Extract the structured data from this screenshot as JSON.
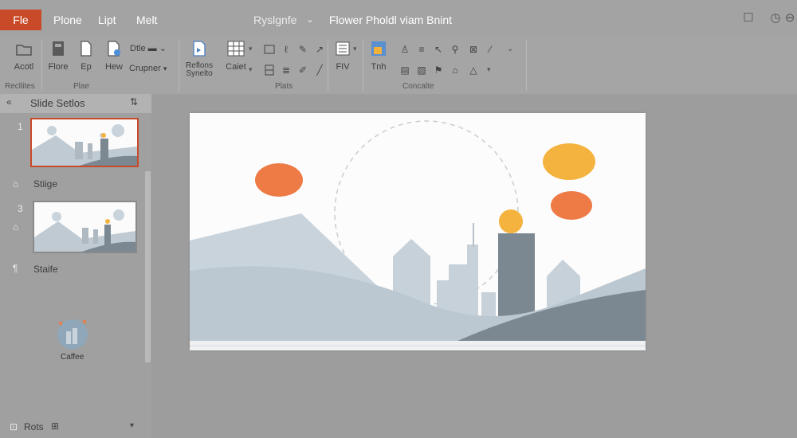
{
  "menu": {
    "file": "Fle",
    "items": [
      "Plone",
      "Lipt",
      "Melt"
    ],
    "doc_title": "Ryslgnfe",
    "app_title": "Flower Pholdl viam Bnint"
  },
  "ribbon": {
    "buttons": {
      "acont": "Acotl",
      "flore": "Flore",
      "ep": "Ep",
      "hew": "Hew",
      "cruprner": "Crupner",
      "reflons": "Reflons\nSynelto",
      "caiet": "Caiet",
      "fiv": "FIV",
      "tnh": "Tnh"
    },
    "groups": {
      "g1": "Recllites",
      "g2": "Plae",
      "g3": "Plats",
      "g4": "Concalte"
    },
    "dd_small": "Dtle"
  },
  "sidebar": {
    "title": "Slide Setlos",
    "slide1_num": "1",
    "label_stiige": "Stiige",
    "slide3_num": "3",
    "label_staife": "Staife",
    "label_caffee": "Caffee",
    "footer": "Rots"
  },
  "colors": {
    "accent_orange": "#c94a28",
    "sun_orange": "#ee7a45",
    "sun_yellow": "#f4b33f",
    "mountain_light": "#c8d3db",
    "building": "#7b8892"
  }
}
